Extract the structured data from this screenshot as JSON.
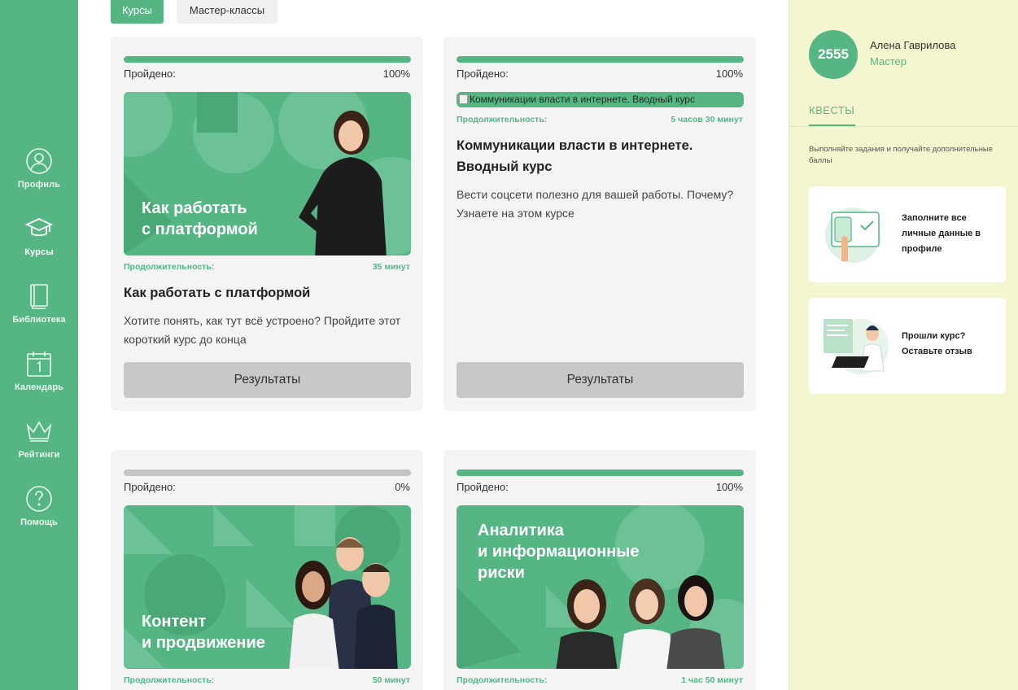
{
  "colors": {
    "accent": "#55b684",
    "sidebar": "#55b684",
    "right_panel": "#f3f6cf",
    "card": "#f4f4f4",
    "button": "#c8c8c8"
  },
  "sidebar": {
    "items": [
      {
        "label": "Профиль",
        "icon": "user-circle-icon"
      },
      {
        "label": "Курсы",
        "icon": "graduation-cap-icon",
        "active": true
      },
      {
        "label": "Библиотека",
        "icon": "book-icon"
      },
      {
        "label": "Календарь",
        "icon": "calendar-icon"
      },
      {
        "label": "Рейтинги",
        "icon": "crown-icon"
      },
      {
        "label": "Помощь",
        "icon": "question-circle-icon"
      }
    ]
  },
  "tabs": [
    {
      "label": "Курсы",
      "active": true
    },
    {
      "label": "Мастер-классы",
      "active": false
    }
  ],
  "courses": [
    {
      "passed_label": "Пройдено:",
      "progress": "100%",
      "progress_fraction": 1.0,
      "banner_text": "Как работать\nс платформой",
      "duration_label": "Продолжительность:",
      "duration": "35 минут",
      "title": "Как работать с платформой",
      "description": "Хотите понять, как тут всё устроено? Пройдите этот короткий курс до конца",
      "button": "Результаты"
    },
    {
      "passed_label": "Пройдено:",
      "progress": "100%",
      "progress_fraction": 1.0,
      "image_alt": "Коммуникации власти в интернете. Вводный курс",
      "duration_label": "Продолжительность:",
      "duration": "5 часов 30 минут",
      "title": "Коммуникации власти в интернете. Вводный курс",
      "description": "Вести соцсети полезно для вашей работы. Почему? Узнаете на этом курсе",
      "button": "Результаты"
    },
    {
      "passed_label": "Пройдено:",
      "progress": "0%",
      "progress_fraction": 0.0,
      "banner_text": "Контент\nи продвижение",
      "duration_label": "Продолжительность:",
      "duration": "50 минут"
    },
    {
      "passed_label": "Пройдено:",
      "progress": "100%",
      "progress_fraction": 1.0,
      "banner_text": "Аналитика\nи информационные\nриски",
      "duration_label": "Продолжительность:",
      "duration": "1 час 50 минут"
    }
  ],
  "profile": {
    "score": "2555",
    "name": "Алена Гаврилова",
    "rank": "Мастер"
  },
  "quests": {
    "tab_label": "КВЕСТЫ",
    "hint": "Выполняйте задания и получайте дополнительные баллы",
    "items": [
      {
        "text": "Заполните все\nличные данные в\nпрофиле",
        "icon": "phone-checklist-illustration"
      },
      {
        "text": "Прошли курс?\nОставьте отзыв",
        "icon": "laptop-person-illustration"
      }
    ]
  }
}
